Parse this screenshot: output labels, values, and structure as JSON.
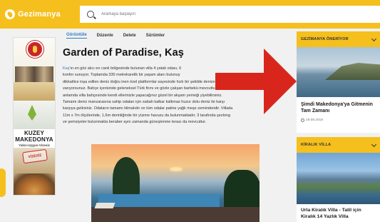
{
  "header": {
    "logo_text": "Gezimanya",
    "search_placeholder": "Aramaya başlayın"
  },
  "tabs": [
    "Görüntüle",
    "Düzenle",
    "Delete",
    "Sürümler"
  ],
  "article": {
    "title": "Garden of Paradise, Kaş",
    "intro_link": "Kaş",
    "lines": [
      "'ın en göz alıcı en canlı bölgesinde bulunan villa 4 yatak odası, 6",
      "konfor sunuyor. Toplamda 330 metrekarelik bir yaşam alanı bulunuy",
      "dikkatlice inşa edilen deniz doğru inen özel platformlar sayesinde hızlı bir şekilde denize",
      "varıyorsunuz. Bahçe içerisinde geleneksel Türk firını ve gözle çalışan barbekü mevcuttur. Bu",
      "anlamda villa bahçesinde kendi ellerinizle yapacağınız güzel bir akşam yemeği yiyebilirsiniz.",
      "Tamamı deniz manzarasına sahip odaları için sabah kalkar kalkmaz huzur dolu deniz ile karşı",
      "karşıya gelirsiniz. Odaların tamamı klimalıdır ve tüm odalar patine yağlı meşe zemindendir. Villada",
      "11m x 7m ölçülerinde, 1,6m derinliğinde bir yüzme havuzu da bulunmaktadır. 3 tarafında şezlong",
      "ve şemsiyeler bulunmakla beraber aynı zamanda güneşlenme terası da mevcuttur."
    ]
  },
  "left_ad": {
    "title": "KUZEY MAKEDONYA",
    "subtitle": "Yakın-Uygun-Vizesiz",
    "stamp": "VİZESİZ"
  },
  "sidebar": {
    "card1": {
      "heading": "GEZİMANYA ÖNERİYOR",
      "title": "Şimdi Makedonya'ya Gitmenin Tam Zamanı",
      "date": "19.08.2018"
    },
    "card2": {
      "heading": "KİRALIK VİLLA",
      "title": "Urla Kiralık Villa - Tatil için Kiralık 14 Yazlık Villa"
    }
  },
  "colors": {
    "brand_yellow": "#f5bf1d",
    "link_blue": "#2f7bc1",
    "arrow_red": "#d9261c"
  }
}
